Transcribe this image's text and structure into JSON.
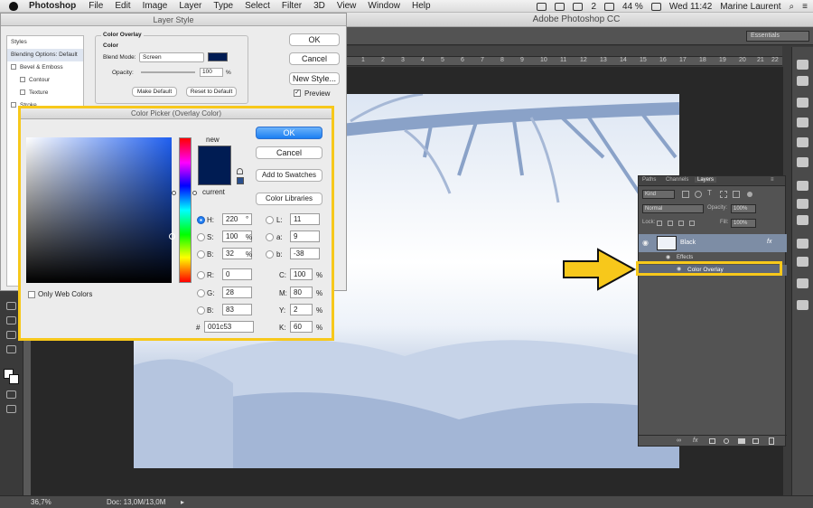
{
  "menubar": {
    "app_name": "Photoshop",
    "items": [
      "File",
      "Edit",
      "Image",
      "Layer",
      "Type",
      "Select",
      "Filter",
      "3D",
      "View",
      "Window",
      "Help"
    ],
    "status_number": "2",
    "battery": "44 %",
    "clock": "Wed 11:42",
    "user": "Marine Laurent"
  },
  "window": {
    "title": "Adobe Photoshop CC",
    "workspace": "Essentials"
  },
  "ruler": {
    "ticks": [
      "0",
      "1",
      "2",
      "3",
      "4",
      "5",
      "6",
      "7",
      "8",
      "9",
      "10",
      "11",
      "12",
      "13",
      "14",
      "15",
      "16",
      "17",
      "18",
      "19",
      "20",
      "21",
      "22"
    ]
  },
  "statusbar": {
    "zoom": "36,7%",
    "doc": "Doc: 13,0M/13,0M"
  },
  "layer_style": {
    "title": "Layer Style",
    "sidebar": {
      "styles": "Styles",
      "blending": "Blending Options: Default",
      "bevel": "Bevel & Emboss",
      "contour": "Contour",
      "texture": "Texture",
      "stroke": "Stroke"
    },
    "section_title": "Color Overlay",
    "section_sub": "Color",
    "blend_mode_label": "Blend Mode:",
    "blend_mode_value": "Screen",
    "opacity_label": "Opacity:",
    "opacity_value": "100",
    "opacity_unit": "%",
    "make_default": "Make Default",
    "reset_default": "Reset to Default",
    "ok": "OK",
    "cancel": "Cancel",
    "new_style": "New Style...",
    "preview": "Preview",
    "overlay_color": "#001c53"
  },
  "color_picker": {
    "title": "Color Picker (Overlay Color)",
    "new_label": "new",
    "current_label": "current",
    "ok": "OK",
    "cancel": "Cancel",
    "add_swatches": "Add to Swatches",
    "color_libraries": "Color Libraries",
    "only_web": "Only Web Colors",
    "h_label": "H:",
    "h_value": "220",
    "h_unit": "°",
    "s_label": "S:",
    "s_value": "100",
    "s_unit": "%",
    "b_label": "B:",
    "b_value": "32",
    "b_unit": "%",
    "r_label": "R:",
    "r_value": "0",
    "g_label": "G:",
    "g_value": "28",
    "bl_label": "B:",
    "bl_value": "83",
    "l_label": "L:",
    "l_value": "11",
    "a_label": "a:",
    "a_value": "9",
    "lb_label": "b:",
    "lb_value": "-38",
    "c_label": "C:",
    "c_value": "100",
    "c_unit": "%",
    "m_label": "M:",
    "m_value": "80",
    "m_unit": "%",
    "y_label": "Y:",
    "y_value": "2",
    "y_unit": "%",
    "k_label": "K:",
    "k_value": "60",
    "k_unit": "%",
    "hex_label": "#",
    "hex_value": "001c53"
  },
  "layers_panel": {
    "tabs": [
      "Paths",
      "Channels",
      "Layers"
    ],
    "kind": "Kind",
    "blend": "Normal",
    "opacity_label": "Opacity:",
    "opacity_value": "100%",
    "lock_label": "Lock:",
    "fill_label": "Fill:",
    "fill_value": "100%",
    "layer_name": "Black",
    "fx": "fx",
    "effects": "Effects",
    "color_overlay": "Color Overlay"
  },
  "colors": {
    "accent_yellow": "#f7c81b",
    "overlay": "#001c53",
    "mac_blue": "#1b7ff2"
  }
}
